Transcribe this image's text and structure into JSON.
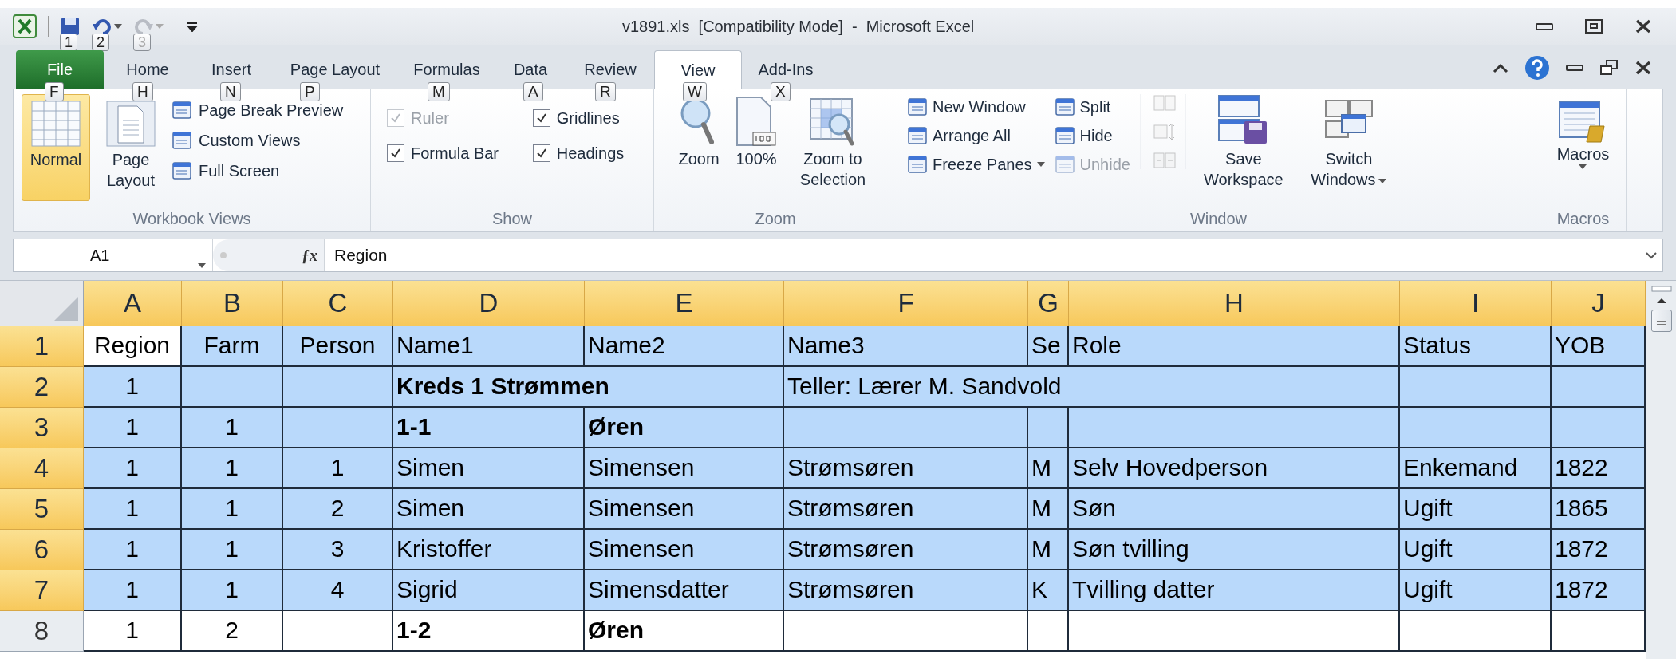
{
  "window": {
    "title": "v1891.xls  [Compatibility Mode]  -  Microsoft Excel"
  },
  "quick_access": [
    {
      "kind": "save",
      "keytip": "1",
      "disabled": false
    },
    {
      "kind": "undo",
      "keytip": "2",
      "disabled": false
    },
    {
      "kind": "redo",
      "keytip": "3",
      "disabled": true
    }
  ],
  "tabs": [
    {
      "label": "File",
      "keytip": "F",
      "selected": false,
      "kind": "file"
    },
    {
      "label": "Home",
      "keytip": "H",
      "selected": false,
      "kind": "tab"
    },
    {
      "label": "Insert",
      "keytip": "N",
      "selected": false,
      "kind": "tab"
    },
    {
      "label": "Page Layout",
      "keytip": "P",
      "selected": false,
      "kind": "tab"
    },
    {
      "label": "Formulas",
      "keytip": "M",
      "selected": false,
      "kind": "tab"
    },
    {
      "label": "Data",
      "keytip": "A",
      "selected": false,
      "kind": "tab"
    },
    {
      "label": "Review",
      "keytip": "R",
      "selected": false,
      "kind": "tab"
    },
    {
      "label": "View",
      "keytip": "W",
      "selected": true,
      "kind": "tab"
    },
    {
      "label": "Add-Ins",
      "keytip": "X",
      "selected": false,
      "kind": "tab"
    }
  ],
  "ribbon": {
    "workbook_views": {
      "label": "Workbook Views",
      "large": [
        {
          "label": "Normal",
          "selected": true
        },
        {
          "label": "Page Layout",
          "selected": false
        }
      ],
      "small": [
        "Page Break Preview",
        "Custom Views",
        "Full Screen"
      ]
    },
    "show": {
      "label": "Show",
      "checkboxes": [
        {
          "label": "Ruler",
          "checked": true,
          "disabled": true
        },
        {
          "label": "Formula Bar",
          "checked": true,
          "disabled": false
        },
        {
          "label": "Gridlines",
          "checked": true,
          "disabled": false
        },
        {
          "label": "Headings",
          "checked": true,
          "disabled": false
        }
      ]
    },
    "zoom": {
      "label": "Zoom",
      "buttons": [
        {
          "label": "Zoom",
          "kind": "zoom"
        },
        {
          "label": "100%",
          "kind": "hundred"
        },
        {
          "label": "Zoom to Selection",
          "kind": "selection"
        }
      ]
    },
    "window": {
      "label": "Window",
      "left": [
        {
          "label": "New Window",
          "dropdown": false,
          "disabled": false
        },
        {
          "label": "Arrange All",
          "dropdown": false,
          "disabled": false
        },
        {
          "label": "Freeze Panes",
          "dropdown": true,
          "disabled": false
        }
      ],
      "right": [
        {
          "label": "Split",
          "disabled": false
        },
        {
          "label": "Hide",
          "disabled": false
        },
        {
          "label": "Unhide",
          "disabled": true
        }
      ],
      "large": [
        {
          "label": "Save Workspace",
          "dropdown": false,
          "kind": "save"
        },
        {
          "label": "Switch Windows",
          "dropdown": true,
          "kind": "switch"
        }
      ]
    },
    "macros": {
      "label": "Macros",
      "button": "Macros"
    }
  },
  "formula_bar": {
    "name_box": "A1",
    "function_button": "ƒx",
    "value": "Region"
  },
  "sheet": {
    "columns": [
      {
        "label": "A",
        "selected": true
      },
      {
        "label": "B",
        "selected": true
      },
      {
        "label": "C",
        "selected": true
      },
      {
        "label": "D",
        "selected": true
      },
      {
        "label": "E",
        "selected": true
      },
      {
        "label": "F",
        "selected": true
      },
      {
        "label": "G",
        "selected": true
      },
      {
        "label": "H",
        "selected": true
      },
      {
        "label": "I",
        "selected": true
      },
      {
        "label": "J",
        "selected": true
      }
    ],
    "rows": [
      {
        "number": "1",
        "selected": true,
        "cells": [
          {
            "text": "Region",
            "bold": false,
            "active": true
          },
          {
            "text": "Farm",
            "bold": false
          },
          {
            "text": "Person",
            "bold": false
          },
          {
            "text": "Name1",
            "bold": false
          },
          {
            "text": "Name2",
            "bold": false
          },
          {
            "text": "Name3",
            "bold": false
          },
          {
            "text": "Se",
            "bold": false
          },
          {
            "text": "Role",
            "bold": false
          },
          {
            "text": "Status",
            "bold": false
          },
          {
            "text": "YOB",
            "bold": false
          }
        ]
      },
      {
        "number": "2",
        "selected": true,
        "cells": [
          {
            "text": "1",
            "bold": false
          },
          null,
          null,
          {
            "text": "Kreds 1 Strømmen",
            "bold": true
          },
          null,
          {
            "text": "Teller: Lærer M. Sandvold",
            "bold": false
          },
          null,
          null,
          null,
          null
        ]
      },
      {
        "number": "3",
        "selected": true,
        "cells": [
          {
            "text": "1",
            "bold": false
          },
          {
            "text": "1",
            "bold": false
          },
          null,
          {
            "text": "1-1",
            "bold": true
          },
          {
            "text": "Øren",
            "bold": true
          },
          null,
          null,
          null,
          null,
          null
        ]
      },
      {
        "number": "4",
        "selected": true,
        "cells": [
          {
            "text": "1",
            "bold": false
          },
          {
            "text": "1",
            "bold": false
          },
          {
            "text": "1",
            "bold": false
          },
          {
            "text": "Simen",
            "bold": false
          },
          {
            "text": "Simensen",
            "bold": false
          },
          {
            "text": "Strømsøren",
            "bold": false
          },
          {
            "text": "M",
            "bold": false
          },
          {
            "text": "Selv Hovedperson",
            "bold": false
          },
          {
            "text": "Enkemand",
            "bold": false
          },
          {
            "text": "1822",
            "bold": false
          }
        ]
      },
      {
        "number": "5",
        "selected": true,
        "cells": [
          {
            "text": "1",
            "bold": false
          },
          {
            "text": "1",
            "bold": false
          },
          {
            "text": "2",
            "bold": false
          },
          {
            "text": "Simen",
            "bold": false
          },
          {
            "text": "Simensen",
            "bold": false
          },
          {
            "text": "Strømsøren",
            "bold": false
          },
          {
            "text": "M",
            "bold": false
          },
          {
            "text": "Søn",
            "bold": false
          },
          {
            "text": "Ugift",
            "bold": false
          },
          {
            "text": "1865",
            "bold": false
          }
        ]
      },
      {
        "number": "6",
        "selected": true,
        "cells": [
          {
            "text": "1",
            "bold": false
          },
          {
            "text": "1",
            "bold": false
          },
          {
            "text": "3",
            "bold": false
          },
          {
            "text": "Kristoffer",
            "bold": false
          },
          {
            "text": "Simensen",
            "bold": false
          },
          {
            "text": "Strømsøren",
            "bold": false
          },
          {
            "text": "M",
            "bold": false
          },
          {
            "text": "Søn tvilling",
            "bold": false
          },
          {
            "text": "Ugift",
            "bold": false
          },
          {
            "text": "1872",
            "bold": false
          }
        ]
      },
      {
        "number": "7",
        "selected": true,
        "cells": [
          {
            "text": "1",
            "bold": false
          },
          {
            "text": "1",
            "bold": false
          },
          {
            "text": "4",
            "bold": false
          },
          {
            "text": "Sigrid",
            "bold": false
          },
          {
            "text": "Simensdatter",
            "bold": false
          },
          {
            "text": "Strømsøren",
            "bold": false
          },
          {
            "text": "K",
            "bold": false
          },
          {
            "text": "Tvilling datter",
            "bold": false
          },
          {
            "text": "Ugift",
            "bold": false
          },
          {
            "text": "1872",
            "bold": false
          }
        ]
      },
      {
        "number": "8",
        "selected": false,
        "cells": [
          {
            "text": "1",
            "bold": false
          },
          {
            "text": "2",
            "bold": false
          },
          null,
          {
            "text": "1-2",
            "bold": true
          },
          {
            "text": "Øren",
            "bold": true
          },
          null,
          null,
          null,
          null,
          null
        ]
      }
    ]
  }
}
